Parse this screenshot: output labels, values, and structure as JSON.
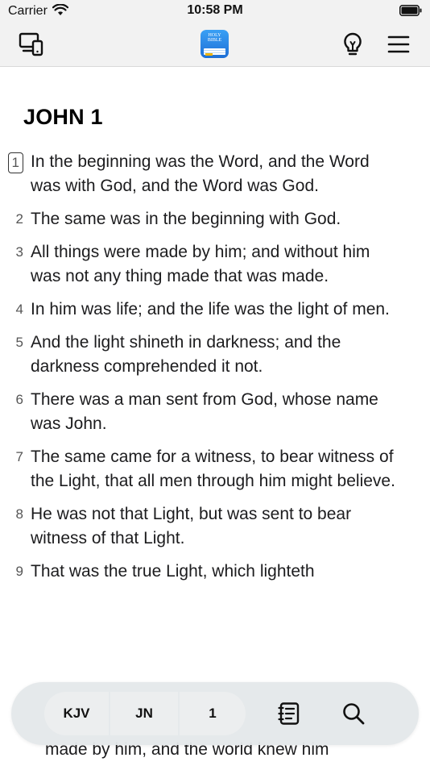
{
  "status_bar": {
    "carrier": "Carrier",
    "time": "10:58 PM"
  },
  "nav": {
    "icons": [
      "devices-icon",
      "app-logo",
      "lightbulb-icon",
      "menu-icon"
    ],
    "logo_text": "HOLY BIBLE"
  },
  "chapter": {
    "title": "JOHN 1"
  },
  "verses": [
    {
      "num": "1",
      "text": "In the beginning was the Word, and the Word was with God, and the Word was God."
    },
    {
      "num": "2",
      "text": "The same was in the beginning with God."
    },
    {
      "num": "3",
      "text": "All things were made by him; and without him was not any thing made that was made."
    },
    {
      "num": "4",
      "text": "In him was life; and the life was the light of men."
    },
    {
      "num": "5",
      "text": "And the light shineth in darkness; and the darkness comprehended it not."
    },
    {
      "num": "6",
      "text": "There was a man sent from God, whose name was John."
    },
    {
      "num": "7",
      "text": "The same came for a witness, to bear witness of the Light, that all men through him might believe."
    },
    {
      "num": "8",
      "text": "He was not that Light, but was sent to bear witness of that Light."
    },
    {
      "num": "9",
      "text": "That was the true Light, which lighteth"
    }
  ],
  "trailing_text": "made by him, and the world knew him",
  "toolbar": {
    "version": "KJV",
    "book": "JN",
    "chapter": "1",
    "icons": [
      "notes-icon",
      "search-icon"
    ]
  },
  "colors": {
    "bar_bg": "#f2f2f2",
    "toolbar_bg": "#e4e8ea",
    "logo_blue": "#1e6fd6"
  }
}
